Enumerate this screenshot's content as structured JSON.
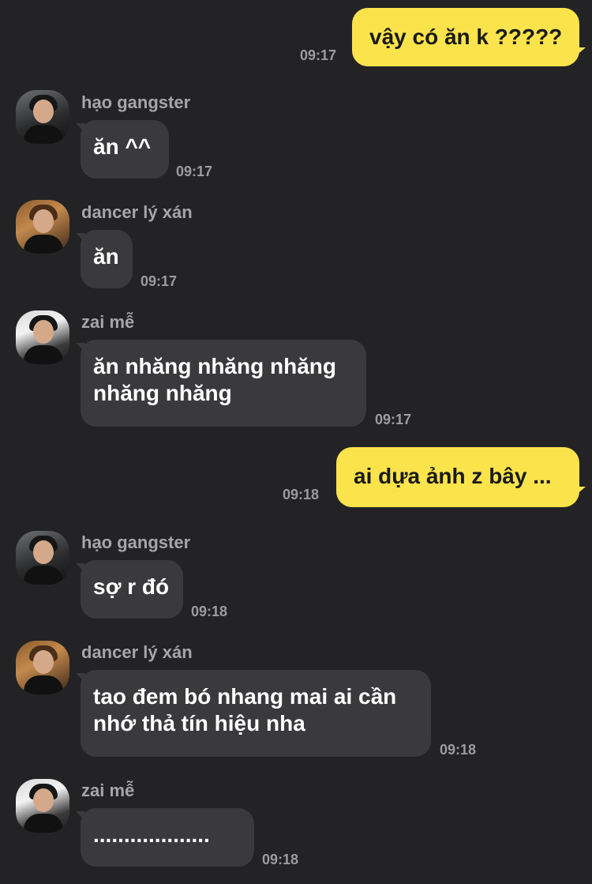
{
  "colors": {
    "background": "#232325",
    "incoming_bubble": "#3a3a3c",
    "outgoing_bubble": "#fbe34c",
    "timestamp": "#9c9ca0",
    "sender_name": "#a6a6aa"
  },
  "messages": [
    {
      "direction": "outgoing",
      "text": "vậy có ăn k ?????",
      "time": "09:17"
    },
    {
      "direction": "incoming",
      "sender": "hạo gangster",
      "avatar": "avatar-photo-hao",
      "lines": [
        "ăn ^^"
      ],
      "time": "09:17"
    },
    {
      "direction": "incoming",
      "sender": "dancer lý xán",
      "avatar": "avatar-photo-dancer",
      "lines": [
        "ăn"
      ],
      "time": "09:17"
    },
    {
      "direction": "incoming",
      "sender": "zai mễ",
      "avatar": "avatar-photo-zai",
      "lines": [
        "ăn nhăng nhăng nhăng",
        "nhăng nhăng"
      ],
      "time": "09:17"
    },
    {
      "direction": "outgoing",
      "text": "ai dựa ảnh z bây ...",
      "time": "09:18"
    },
    {
      "direction": "incoming",
      "sender": "hạo gangster",
      "avatar": "avatar-photo-hao",
      "lines": [
        "sợ r đó"
      ],
      "time": "09:18"
    },
    {
      "direction": "incoming",
      "sender": "dancer lý xán",
      "avatar": "avatar-photo-dancer",
      "lines": [
        "tao đem bó nhang mai ai cần",
        "nhớ thả tín hiệu nha"
      ],
      "time": "09:18"
    },
    {
      "direction": "incoming",
      "sender": "zai mễ",
      "avatar": "avatar-photo-zai",
      "lines": [
        "..................."
      ],
      "time": "09:18"
    }
  ]
}
